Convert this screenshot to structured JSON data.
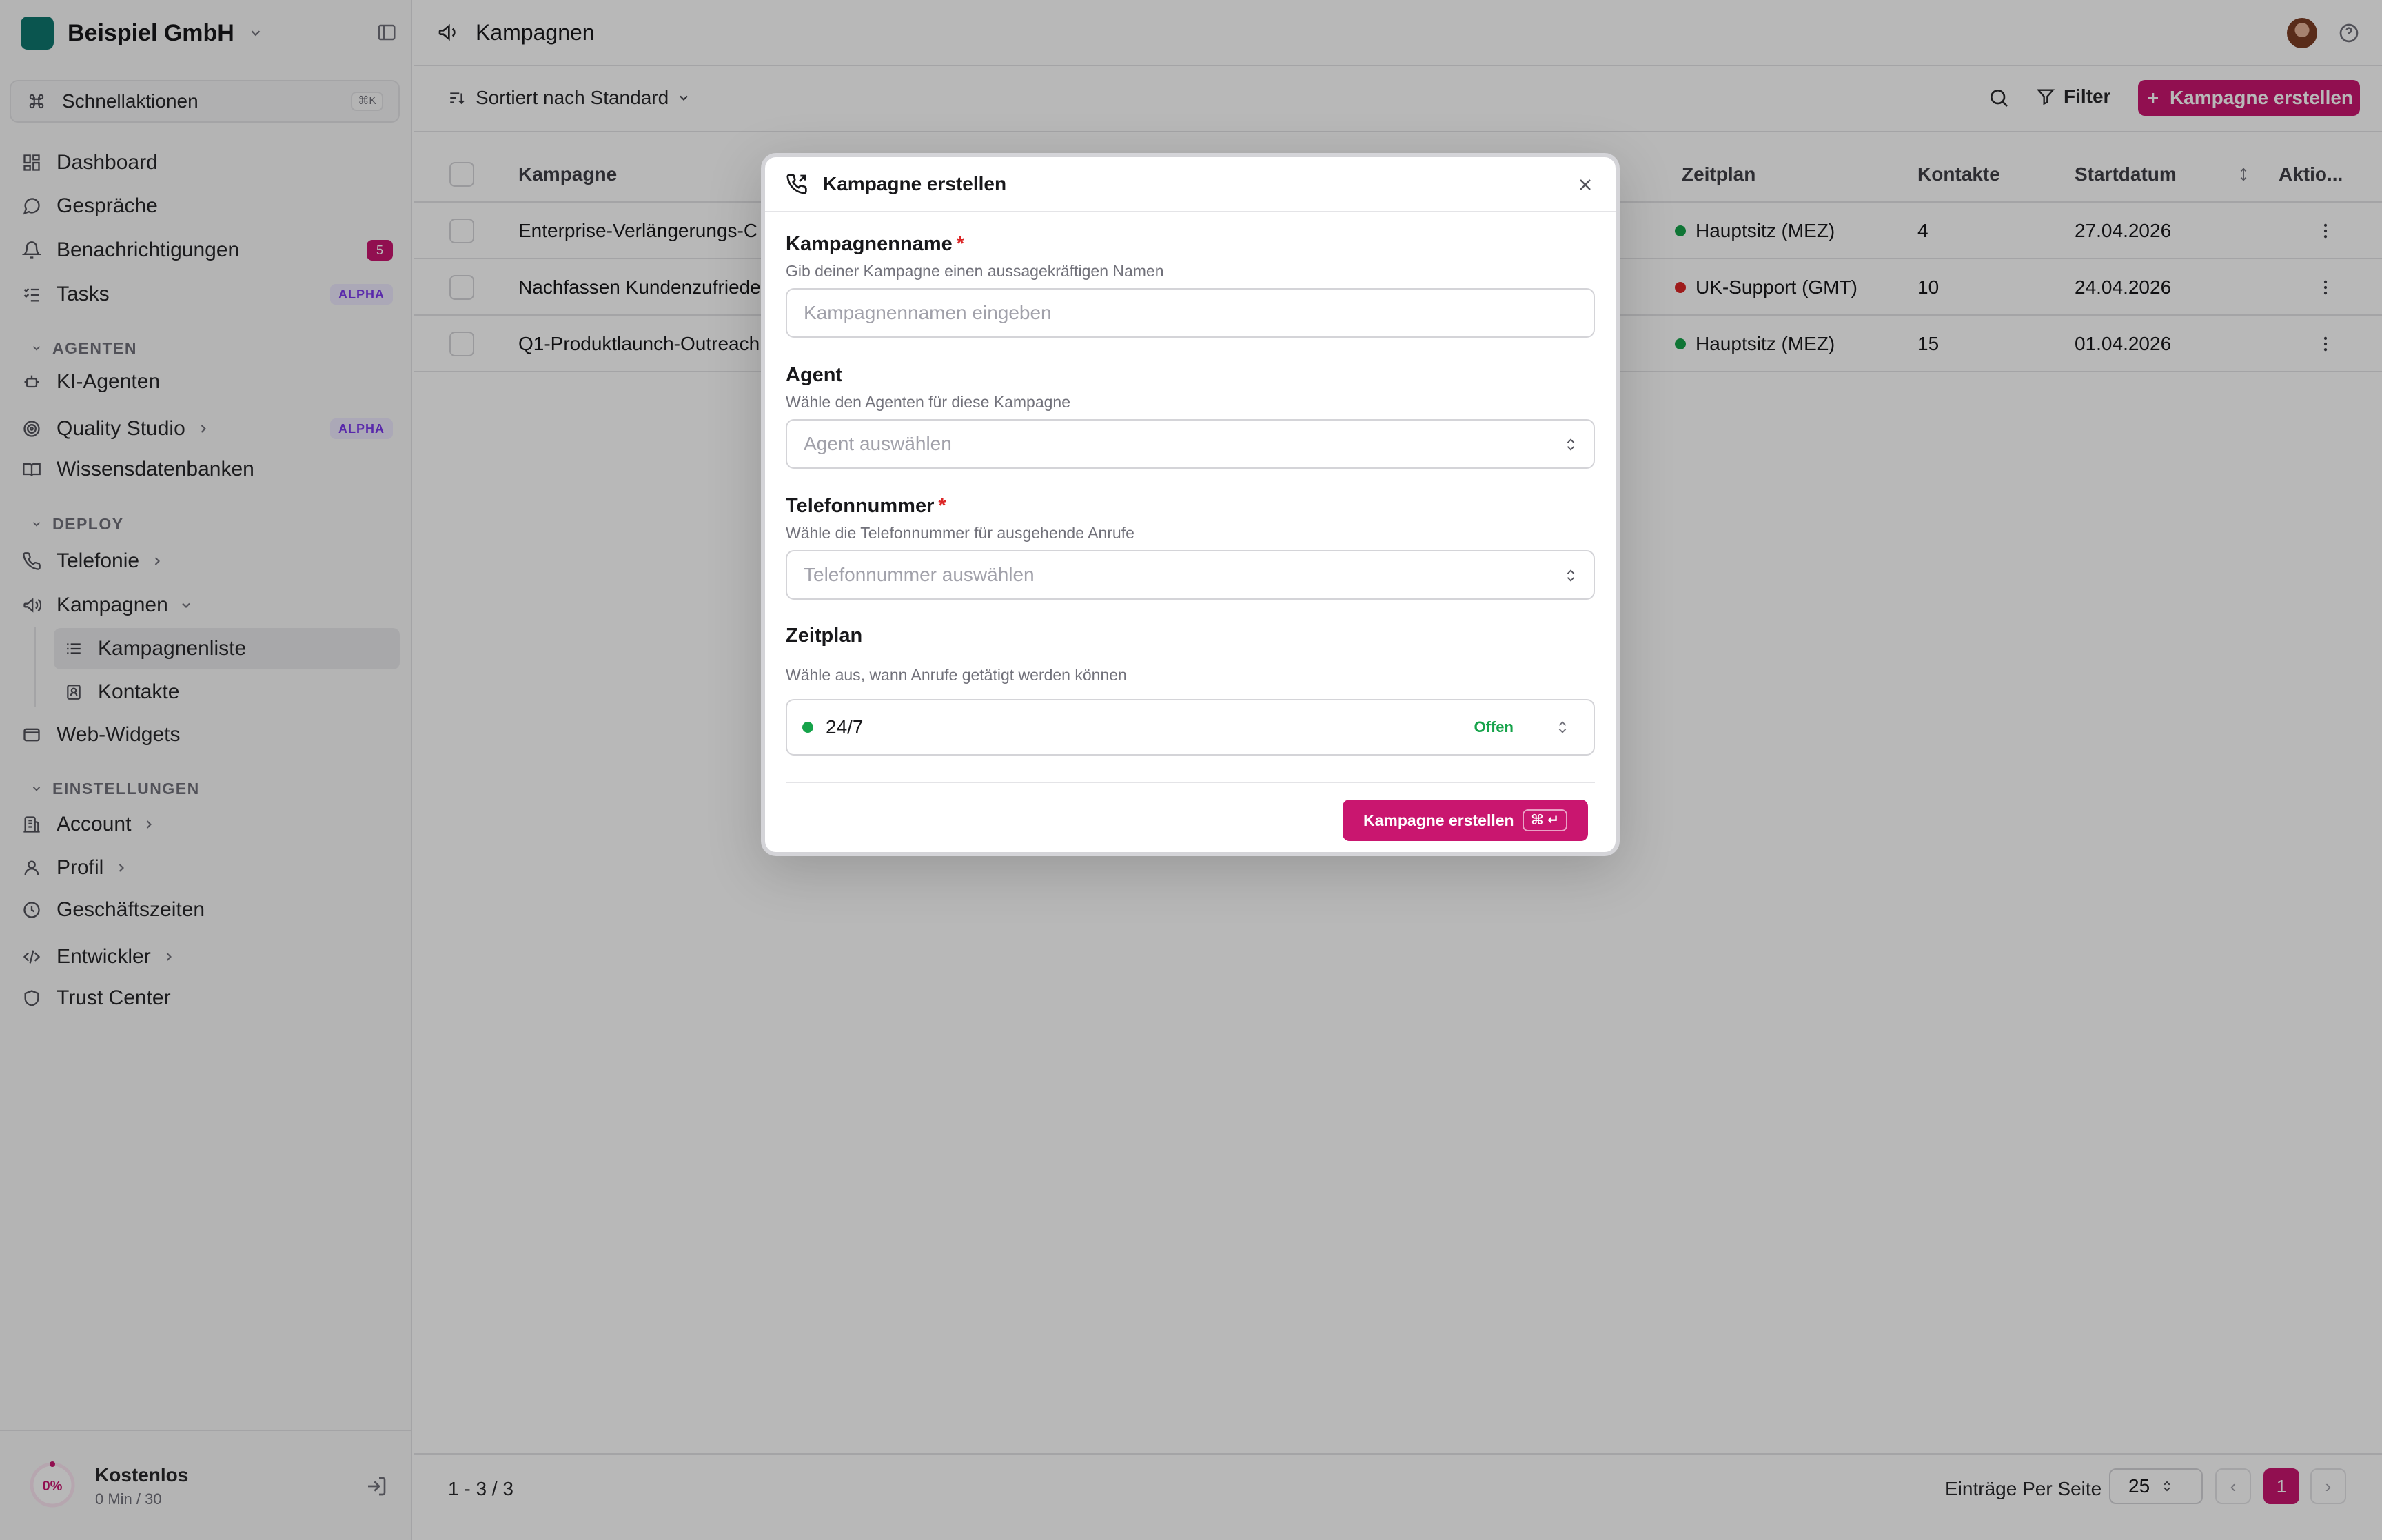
{
  "sidebar": {
    "org_name": "Beispiel GmbH",
    "quick_actions": {
      "label": "Schnellaktionen",
      "shortcut": "⌘K"
    },
    "nav": {
      "dashboard": "Dashboard",
      "gespraeche": "Gespräche",
      "benachrichtigungen": "Benachrichtigungen",
      "benachrichtigungen_count": "5",
      "tasks": "Tasks",
      "tasks_badge": "ALPHA"
    },
    "sections": {
      "agenten": "AGENTEN",
      "deploy": "DEPLOY",
      "einstellungen": "EINSTELLUNGEN"
    },
    "agenten": {
      "ki_agenten": "KI-Agenten",
      "quality_studio": "Quality Studio",
      "quality_studio_badge": "ALPHA",
      "wissensdatenbanken": "Wissensdatenbanken"
    },
    "deploy": {
      "telefonie": "Telefonie",
      "kampagnen": "Kampagnen",
      "kampagnenliste": "Kampagnenliste",
      "kontakte": "Kontakte",
      "web_widgets": "Web-Widgets"
    },
    "einstellungen": {
      "account": "Account",
      "profil": "Profil",
      "geschaeftszeiten": "Geschäftszeiten",
      "entwickler": "Entwickler",
      "trust_center": "Trust Center"
    },
    "plan": {
      "usage_percent_label": "0%",
      "usage_fraction": 0.0,
      "name": "Kostenlos",
      "minutes": "0 Min / 30"
    }
  },
  "topbar": {
    "title": "Kampagnen"
  },
  "toolbar": {
    "sort_label": "Sortiert nach Standard",
    "filter_label": "Filter",
    "create_label": "Kampagne erstellen"
  },
  "table": {
    "headers": {
      "kampagne": "Kampagne",
      "zeitplan": "Zeitplan",
      "kontakte": "Kontakte",
      "startdatum": "Startdatum",
      "aktionen": "Aktio..."
    },
    "rows": [
      {
        "name": "Enterprise-Verlängerungs-C",
        "zeitplan": "Hauptsitz (MEZ)",
        "status_color": "#16a34a",
        "kontakte": "4",
        "startdatum": "27.04.2026"
      },
      {
        "name": "Nachfassen Kundenzufriede",
        "zeitplan": "UK-Support (GMT)",
        "status_color": "#dc2626",
        "kontakte": "10",
        "startdatum": "24.04.2026"
      },
      {
        "name": "Q1-Produktlaunch-Outreach",
        "zeitplan": "Hauptsitz (MEZ)",
        "status_color": "#16a34a",
        "kontakte": "15",
        "startdatum": "01.04.2026"
      }
    ]
  },
  "pagination": {
    "range": "1 - 3 / 3",
    "per_page_label": "Einträge Per Seite",
    "per_page_value": "25",
    "prev": "‹",
    "current_page": "1",
    "next": "›"
  },
  "modal": {
    "title": "Kampagne erstellen",
    "name_label": "Kampagnenname",
    "required_mark": "*",
    "name_help": "Gib deiner Kampagne einen aussagekräftigen Namen",
    "name_placeholder": "Kampagnennamen eingeben",
    "agent_label": "Agent",
    "agent_help": "Wähle den Agenten für diese Kampagne",
    "agent_placeholder": "Agent auswählen",
    "phone_label": "Telefonnummer",
    "phone_help": "Wähle die Telefonnummer für ausgehende Anrufe",
    "phone_placeholder": "Telefonnummer auswählen",
    "schedule_label": "Zeitplan",
    "schedule_help": "Wähle aus, wann Anrufe getätigt werden können",
    "schedule_value": "24/7",
    "schedule_status": "Offen",
    "submit_label": "Kampagne erstellen",
    "submit_shortcut": "⌘ ↵"
  },
  "colors": {
    "accent": "#c9166f",
    "ok": "#16a34a",
    "error": "#dc2626"
  }
}
